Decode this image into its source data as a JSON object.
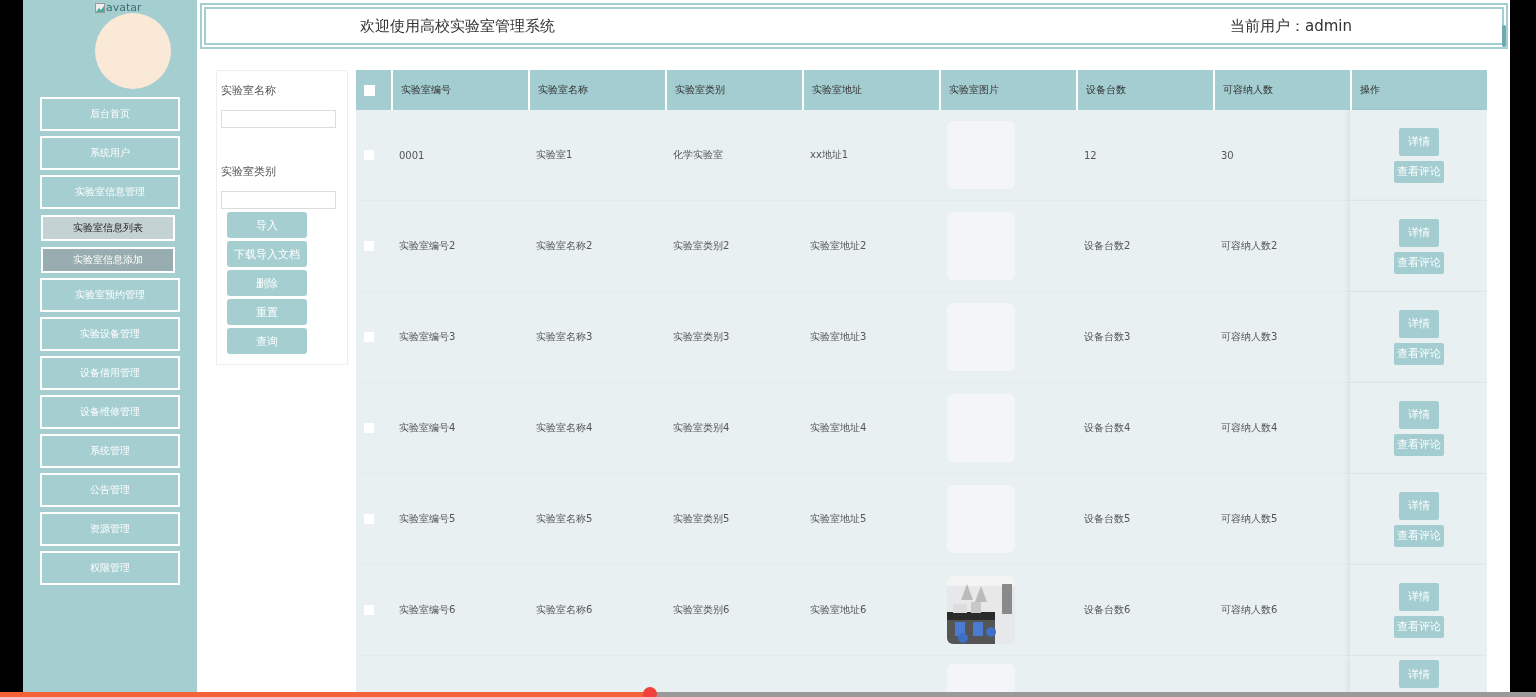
{
  "sidebar": {
    "avatar_alt": "avatar",
    "items": [
      {
        "label": "后台首页",
        "kind": "menu",
        "selected": false
      },
      {
        "label": "系统用户",
        "kind": "menu",
        "selected": false
      },
      {
        "label": "实验室信息管理",
        "kind": "menu",
        "selected": false,
        "children": [
          {
            "label": "实验室信息列表",
            "kind": "submenu",
            "selected": true
          },
          {
            "label": "实验室信息添加",
            "kind": "submenu",
            "selected": false
          }
        ]
      },
      {
        "label": "实验室预约管理",
        "kind": "menu",
        "selected": false
      },
      {
        "label": "实验设备管理",
        "kind": "menu",
        "selected": false
      },
      {
        "label": "设备借用管理",
        "kind": "menu",
        "selected": false
      },
      {
        "label": "设备维修管理",
        "kind": "menu",
        "selected": false
      },
      {
        "label": "系统管理",
        "kind": "menu",
        "selected": false
      },
      {
        "label": "公告管理",
        "kind": "menu",
        "selected": false
      },
      {
        "label": "资源管理",
        "kind": "menu",
        "selected": false
      },
      {
        "label": "权限管理",
        "kind": "menu",
        "selected": false
      }
    ]
  },
  "header": {
    "title": "欢迎使用高校实验室管理系统",
    "user": "当前用户：admin"
  },
  "search": {
    "fields": [
      {
        "label": "实验室名称"
      },
      {
        "label": "实验室类别"
      }
    ],
    "buttons": [
      "导入",
      "下载导入文档",
      "删除",
      "重置",
      "查询"
    ]
  },
  "table": {
    "select_all_checked": false,
    "columns": [
      "实验室编号",
      "实验室名称",
      "实验室类别",
      "实验室地址",
      "实验室图片",
      "设备台数",
      "可容纳人数",
      "操作"
    ],
    "rows": [
      {
        "checked": false,
        "cells": [
          "0001",
          "实验室1",
          "化学实验室",
          "xx地址1"
        ],
        "image": {
          "kind": "placeholder"
        },
        "cells2": [
          "12",
          "30"
        ],
        "actions": [
          "详情",
          "查看评论"
        ]
      },
      {
        "checked": false,
        "cells": [
          "实验室编号2",
          "实验室名称2",
          "实验室类别2",
          "实验室地址2"
        ],
        "image": {
          "kind": "placeholder"
        },
        "cells2": [
          "设备台数2",
          "可容纳人数2"
        ],
        "actions": [
          "详情",
          "查看评论"
        ]
      },
      {
        "checked": false,
        "cells": [
          "实验室编号3",
          "实验室名称3",
          "实验室类别3",
          "实验室地址3"
        ],
        "image": {
          "kind": "placeholder"
        },
        "cells2": [
          "设备台数3",
          "可容纳人数3"
        ],
        "actions": [
          "详情",
          "查看评论"
        ]
      },
      {
        "checked": false,
        "cells": [
          "实验室编号4",
          "实验室名称4",
          "实验室类别4",
          "实验室地址4"
        ],
        "image": {
          "kind": "placeholder"
        },
        "cells2": [
          "设备台数4",
          "可容纳人数4"
        ],
        "actions": [
          "详情",
          "查看评论"
        ]
      },
      {
        "checked": false,
        "cells": [
          "实验室编号5",
          "实验室名称5",
          "实验室类别5",
          "实验室地址5"
        ],
        "image": {
          "kind": "placeholder"
        },
        "cells2": [
          "设备台数5",
          "可容纳人数5"
        ],
        "actions": [
          "详情",
          "查看评论"
        ]
      },
      {
        "checked": false,
        "cells": [
          "实验室编号6",
          "实验室名称6",
          "实验室类别6",
          "实验室地址6"
        ],
        "image": {
          "kind": "picture"
        },
        "cells2": [
          "设备台数6",
          "可容纳人数6"
        ],
        "actions": [
          "详情",
          "查看评论"
        ]
      },
      {
        "image": {
          "kind": "placeholder"
        },
        "actions": [
          "详情"
        ]
      }
    ]
  },
  "player": {
    "level": 0.423
  }
}
